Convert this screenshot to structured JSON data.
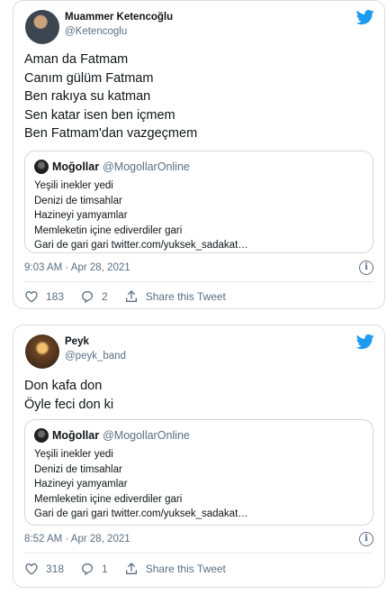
{
  "colors": {
    "accent": "#1d9bf0",
    "muted": "#5b7083",
    "text": "#0f1419"
  },
  "tweets": [
    {
      "author_name": "Muammer Ketencoğlu",
      "author_handle": "@Ketencoglu",
      "lines": [
        "Aman da Fatmam",
        "Canım gülüm Fatmam",
        "Ben rakıya su katman",
        "Sen katar isen ben içmem",
        "Ben Fatmam'dan vazgeçmem"
      ],
      "quote": {
        "name": "Moğollar",
        "handle": "@MogollarOnline",
        "lines": [
          "Yeşili inekler yedi",
          "Denizi de timsahlar",
          "Hazineyi yamyamlar",
          "Memleketin içine ediverdiler gari",
          "Gari de gari gari twitter.com/yuksek_sadakat…"
        ]
      },
      "timestamp": "9:03 AM · Apr 28, 2021",
      "likes": "183",
      "replies": "2",
      "share_label": "Share this Tweet"
    },
    {
      "author_name": "Peyk",
      "author_handle": "@peyk_band",
      "lines": [
        "Don kafa don",
        "Öyle feci don ki"
      ],
      "quote": {
        "name": "Moğollar",
        "handle": "@MogollarOnline",
        "lines": [
          "Yeşili inekler yedi",
          "Denizi de timsahlar",
          "Hazineyi yamyamlar",
          "Memleketin içine ediverdiler gari",
          "Gari de gari gari twitter.com/yuksek_sadakat…"
        ]
      },
      "timestamp": "8:52 AM · Apr 28, 2021",
      "likes": "318",
      "replies": "1",
      "share_label": "Share this Tweet"
    }
  ],
  "icons": {
    "brand": "twitter-bird-icon",
    "info": "info-icon",
    "like": "heart-icon",
    "reply": "reply-bubble-icon",
    "share": "share-icon"
  }
}
